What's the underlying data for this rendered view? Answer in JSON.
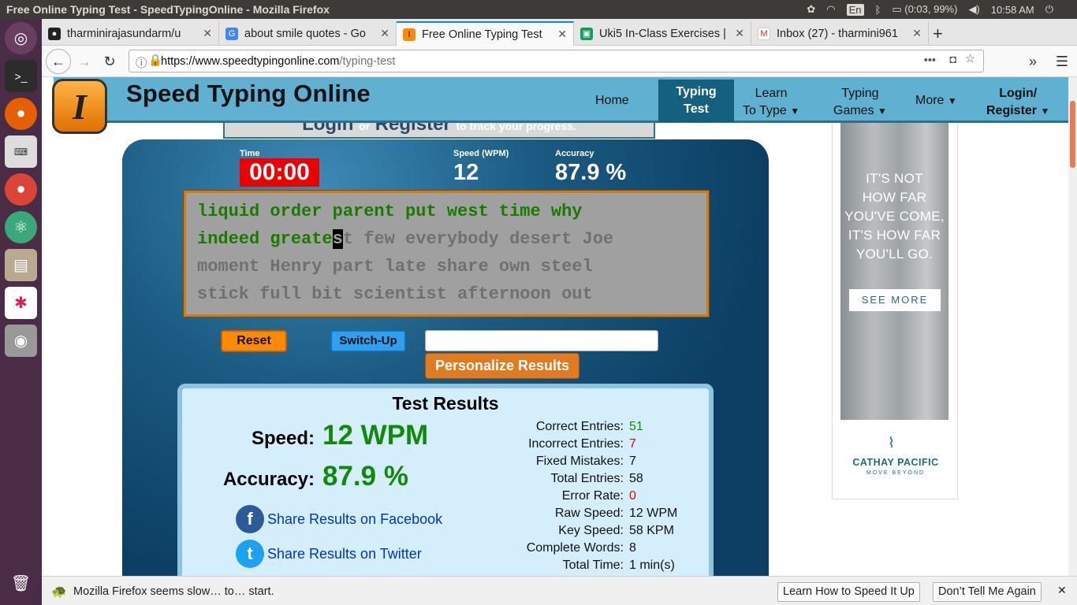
{
  "os": {
    "window_title": "Free Online Typing Test - SpeedTypingOnline - Mozilla Firefox",
    "keyboard": "En",
    "battery": "(0:03, 99%)",
    "clock": "10:58 AM"
  },
  "tabs": [
    {
      "label": "tharminirajasundarm/u",
      "icon": "github-icon"
    },
    {
      "label": "about smile quotes - Go",
      "icon": "google-icon"
    },
    {
      "label": "Free Online Typing Test",
      "icon": "speedtyping-icon"
    },
    {
      "label": "Uki5 In-Class Exercises |",
      "icon": "classroom-icon"
    },
    {
      "label": "Inbox (27) - tharmini961",
      "icon": "gmail-icon"
    }
  ],
  "url": {
    "domain": "https://www.speedtypingonline.com",
    "path": "/typing-test"
  },
  "site": {
    "name": "Speed Typing Online",
    "logo_letter": "I",
    "nav": {
      "home": "Home",
      "typing_test_1": "Typing",
      "typing_test_2": "Test",
      "learn_1": "Learn",
      "learn_2": "To Type",
      "games_1": "Typing",
      "games_2": "Games",
      "more": "More",
      "login_1": "Login/",
      "login_2": "Register"
    },
    "login_banner": {
      "login": "Login",
      "or": "or",
      "register": "Register",
      "tail": "to track your progress."
    }
  },
  "test": {
    "time_label": "Time",
    "time_value": "00:00",
    "speed_label": "Speed (WPM)",
    "speed_value": "12",
    "accuracy_label": "Accuracy",
    "accuracy_value": "87.9 %",
    "lines": {
      "l1_typed": "liquid order parent put west time why",
      "l2_typed": "indeed greate",
      "l2_cursor": "s",
      "l2_rest": "t few everybody desert Joe",
      "l3": "moment Henry part late share own steel",
      "l4": "stick full bit scientist afternoon out"
    },
    "reset_label": "Reset",
    "switch_label": "Switch-Up",
    "personalize_label": "Personalize Results"
  },
  "results": {
    "title": "Test Results",
    "speed_label": "Speed:",
    "speed_value": "12 WPM",
    "accuracy_label": "Accuracy:",
    "accuracy_value": "87.9 %",
    "share_facebook": "Share Results on Facebook",
    "share_twitter": "Share Results on Twitter",
    "rows": [
      {
        "k": "Correct Entries:",
        "v": "51"
      },
      {
        "k": "Incorrect Entries:",
        "v": "7"
      },
      {
        "k": "Fixed Mistakes:",
        "v": "7"
      },
      {
        "k": "Total Entries:",
        "v": "58"
      },
      {
        "k": "Error Rate:",
        "v": "0"
      },
      {
        "k": "Raw Speed:",
        "v": "12 WPM"
      },
      {
        "k": "Key Speed:",
        "v": "58 KPM"
      },
      {
        "k": "Complete Words:",
        "v": "8"
      },
      {
        "k": "Total Time:",
        "v": "1 min(s)"
      }
    ]
  },
  "ad": {
    "l1": "IT'S NOT",
    "l2": "HOW FAR",
    "l3": "YOU'VE COME,",
    "l4": "IT'S HOW FAR",
    "l5": "YOU'LL GO.",
    "cta": "SEE MORE",
    "brand": "CATHAY PACIFIC",
    "tagline": "MOVE BEYOND"
  },
  "notification": {
    "message": "Mozilla Firefox seems slow… to… start.",
    "learn_btn": "Learn How to Speed It Up",
    "dismiss_btn": "Don’t Tell Me Again"
  },
  "colors": {
    "accent": "#5fb0d1",
    "panel": "#1b5a82",
    "ok_text": "#1a7a00",
    "time_box": "#e00000"
  }
}
